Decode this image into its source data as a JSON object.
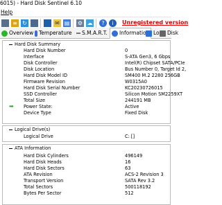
{
  "window": {
    "title": "6015) - Hard Disk Sentinel 6.10"
  },
  "menu": {
    "help": "Help"
  },
  "toolbar": {
    "unregistered": "Unregistered version"
  },
  "tabs": [
    {
      "label": "Overview",
      "icon": "check-circle-icon",
      "color": "#2bb52b"
    },
    {
      "label": "Temperature",
      "icon": "thermometer-icon",
      "color": "#3a6fd8"
    },
    {
      "label": "S.M.A.R.T.",
      "icon": "smart-dots-icon",
      "color": "#555555"
    },
    {
      "label": "Information",
      "icon": "info-icon",
      "color": "#2f6fd6"
    },
    {
      "label": "Log",
      "icon": "log-icon",
      "color": "#2f6fd6"
    },
    {
      "label": "Disk",
      "icon": "disk-icon",
      "color": "#555555"
    }
  ],
  "sections": {
    "summary": {
      "title": "Hard Disk Summary",
      "rows": [
        {
          "label": "Hard Disk Number",
          "value": "0"
        },
        {
          "label": "Interface",
          "value": "S-ATA Gen3, 6 Gbps"
        },
        {
          "label": "Disk Controller",
          "value": "Intel(R) Chipset SATA/PCIe"
        },
        {
          "label": "Disk Location",
          "value": "Bus Number 0, Target Id 2,"
        },
        {
          "label": "Hard Disk Model ID",
          "value": "SM400 M.2 2280 256GB"
        },
        {
          "label": "Firmware Revision",
          "value": "W0315A0"
        },
        {
          "label": "Hard Disk Serial Number",
          "value": "KC20230726015"
        },
        {
          "label": "SSD Controller",
          "value": "Silicon Motion SM2259XT"
        },
        {
          "label": "Total Size",
          "value": "244191 MB"
        },
        {
          "label": "Power State:",
          "value": "Active"
        },
        {
          "label": "Device Type",
          "value": "Fixed Disk"
        }
      ]
    },
    "logical": {
      "title": "Logical Drive(s)",
      "rows": [
        {
          "label": "Logical Drive",
          "value": "C: []"
        }
      ]
    },
    "ata": {
      "title": "ATA Information",
      "rows": [
        {
          "label": "Hard Disk Cylinders",
          "value": "496149"
        },
        {
          "label": "Hard Disk Heads",
          "value": "16"
        },
        {
          "label": "Hard Disk Sectors",
          "value": "63"
        },
        {
          "label": "ATA Revision",
          "value": "ACS-2 Revision 3"
        },
        {
          "label": "Transport Version",
          "value": "SATA Rev 3.2"
        },
        {
          "label": "Total Sectors",
          "value": "500118192"
        },
        {
          "label": "Bytes Per Sector",
          "value": "512"
        }
      ]
    }
  }
}
